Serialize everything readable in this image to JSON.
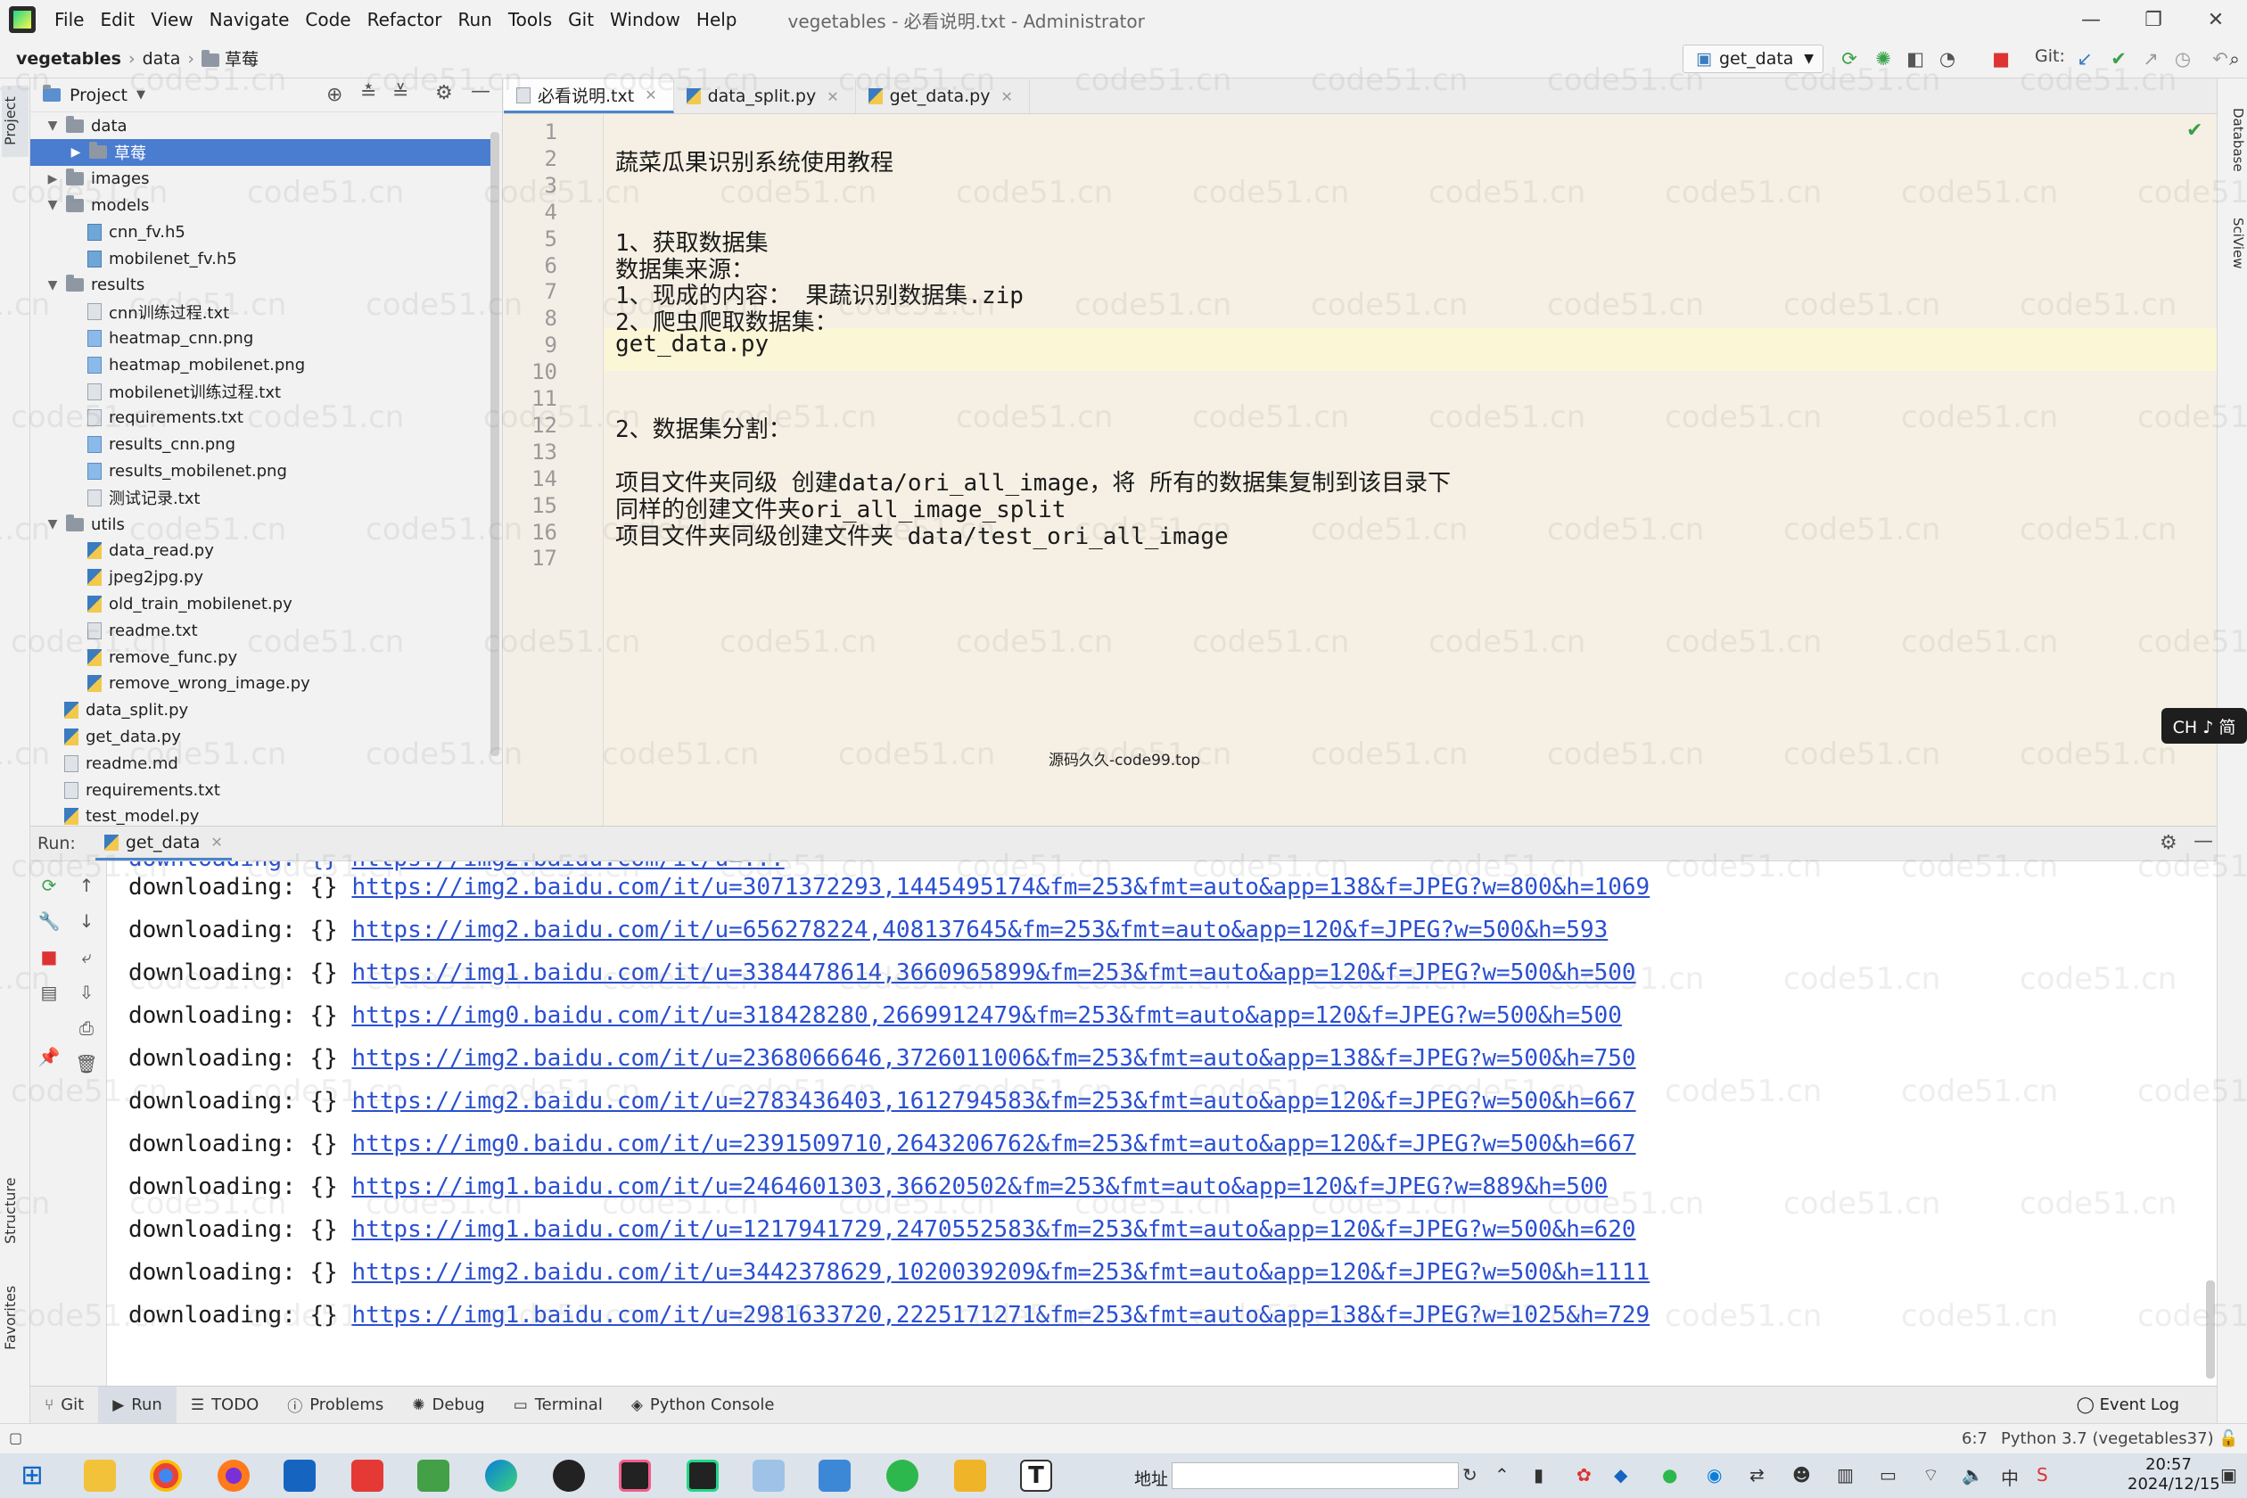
{
  "menu": {
    "items": [
      "File",
      "Edit",
      "View",
      "Navigate",
      "Code",
      "Refactor",
      "Run",
      "Tools",
      "Git",
      "Window",
      "Help"
    ],
    "window_title": "vegetables - 必看说明.txt - Administrator"
  },
  "window_controls": {
    "minimize": "—",
    "maximize": "❐",
    "close": "✕"
  },
  "breadcrumb": {
    "root": "vegetables",
    "folder": "data",
    "subfolder": "草莓"
  },
  "toolbar": {
    "run_config": "get_data",
    "git_label": "Git:"
  },
  "side_tabs": {
    "project": "Project",
    "structure": "Structure",
    "favorites": "Favorites",
    "database": "Database",
    "sciview": "SciView"
  },
  "project": {
    "title": "Project",
    "tree": [
      {
        "label": "data",
        "type": "folder",
        "depth": 1,
        "expanded": true
      },
      {
        "label": "草莓",
        "type": "folder",
        "depth": 2,
        "expanded": false,
        "selected": true
      },
      {
        "label": "images",
        "type": "folder",
        "depth": 1,
        "expanded": false
      },
      {
        "label": "models",
        "type": "folder",
        "depth": 1,
        "expanded": true
      },
      {
        "label": "cnn_fv.h5",
        "type": "h5",
        "depth": 2
      },
      {
        "label": "mobilenet_fv.h5",
        "type": "h5",
        "depth": 2
      },
      {
        "label": "results",
        "type": "folder",
        "depth": 1,
        "expanded": true
      },
      {
        "label": "cnn训练过程.txt",
        "type": "txt",
        "depth": 2
      },
      {
        "label": "heatmap_cnn.png",
        "type": "png",
        "depth": 2
      },
      {
        "label": "heatmap_mobilenet.png",
        "type": "png",
        "depth": 2
      },
      {
        "label": "mobilenet训练过程.txt",
        "type": "txt",
        "depth": 2
      },
      {
        "label": "requirements.txt",
        "type": "txt",
        "depth": 2
      },
      {
        "label": "results_cnn.png",
        "type": "png",
        "depth": 2
      },
      {
        "label": "results_mobilenet.png",
        "type": "png",
        "depth": 2
      },
      {
        "label": "测试记录.txt",
        "type": "txt",
        "depth": 2
      },
      {
        "label": "utils",
        "type": "folder",
        "depth": 1,
        "expanded": true
      },
      {
        "label": "data_read.py",
        "type": "py",
        "depth": 2
      },
      {
        "label": "jpeg2jpg.py",
        "type": "py",
        "depth": 2
      },
      {
        "label": "old_train_mobilenet.py",
        "type": "py",
        "depth": 2
      },
      {
        "label": "readme.txt",
        "type": "txt",
        "depth": 2
      },
      {
        "label": "remove_func.py",
        "type": "py",
        "depth": 2
      },
      {
        "label": "remove_wrong_image.py",
        "type": "py",
        "depth": 2
      },
      {
        "label": "data_split.py",
        "type": "py",
        "depth": 1
      },
      {
        "label": "get_data.py",
        "type": "py",
        "depth": 1
      },
      {
        "label": "readme.md",
        "type": "txt",
        "depth": 1
      },
      {
        "label": "requirements.txt",
        "type": "txt",
        "depth": 1
      },
      {
        "label": "test_model.py",
        "type": "py",
        "depth": 1
      }
    ]
  },
  "editor": {
    "tabs": [
      {
        "label": "必看说明.txt",
        "kind": "txt",
        "active": true
      },
      {
        "label": "data_split.py",
        "kind": "py",
        "active": false
      },
      {
        "label": "get_data.py",
        "kind": "py",
        "active": false
      }
    ],
    "lines": [
      {
        "no": "1",
        "text": ""
      },
      {
        "no": "2",
        "text": "蔬菜瓜果识别系统使用教程"
      },
      {
        "no": "3",
        "text": ""
      },
      {
        "no": "4",
        "text": ""
      },
      {
        "no": "5",
        "text": "1、获取数据集"
      },
      {
        "no": "6",
        "text": "数据集来源："
      },
      {
        "no": "7",
        "text": "1、现成的内容： 果蔬识别数据集.zip"
      },
      {
        "no": "8",
        "text": "2、爬虫爬取数据集："
      },
      {
        "no": "9",
        "text": "get_data.py"
      },
      {
        "no": "10",
        "text": ""
      },
      {
        "no": "11",
        "text": ""
      },
      {
        "no": "12",
        "text": "2、数据集分割："
      },
      {
        "no": "13",
        "text": ""
      },
      {
        "no": "14",
        "text": "项目文件夹同级 创建data/ori_all_image，将 所有的数据集复制到该目录下"
      },
      {
        "no": "15",
        "text": "同样的创建文件夹ori_all_image_split"
      },
      {
        "no": "16",
        "text": "项目文件夹同级创建文件夹 data/test_ori_all_image"
      },
      {
        "no": "17",
        "text": ""
      }
    ],
    "overlay_caption": "源码久久-code99.top",
    "ime_badge": "CH ♪ 简"
  },
  "run": {
    "label": "Run:",
    "tab": "get_data",
    "lines": [
      {
        "prefix": "downloading: {} ",
        "url": "https://img2.baidu.com/it/u=3071372293,1445495174&fm=253&fmt=auto&app=138&f=JPEG?w=800&h=1069"
      },
      {
        "prefix": "downloading: {} ",
        "url": "https://img2.baidu.com/it/u=656278224,408137645&fm=253&fmt=auto&app=120&f=JPEG?w=500&h=593"
      },
      {
        "prefix": "downloading: {} ",
        "url": "https://img1.baidu.com/it/u=3384478614,3660965899&fm=253&fmt=auto&app=120&f=JPEG?w=500&h=500"
      },
      {
        "prefix": "downloading: {} ",
        "url": "https://img0.baidu.com/it/u=318428280,2669912479&fm=253&fmt=auto&app=120&f=JPEG?w=500&h=500"
      },
      {
        "prefix": "downloading: {} ",
        "url": "https://img2.baidu.com/it/u=2368066646,3726011006&fm=253&fmt=auto&app=138&f=JPEG?w=500&h=750"
      },
      {
        "prefix": "downloading: {} ",
        "url": "https://img2.baidu.com/it/u=2783436403,1612794583&fm=253&fmt=auto&app=120&f=JPEG?w=500&h=667"
      },
      {
        "prefix": "downloading: {} ",
        "url": "https://img0.baidu.com/it/u=2391509710,2643206762&fm=253&fmt=auto&app=120&f=JPEG?w=500&h=667"
      },
      {
        "prefix": "downloading: {} ",
        "url": "https://img1.baidu.com/it/u=2464601303,36620502&fm=253&fmt=auto&app=120&f=JPEG?w=889&h=500"
      },
      {
        "prefix": "downloading: {} ",
        "url": "https://img1.baidu.com/it/u=1217941729,2470552583&fm=253&fmt=auto&app=120&f=JPEG?w=500&h=620"
      },
      {
        "prefix": "downloading: {} ",
        "url": "https://img2.baidu.com/it/u=3442378629,1020039209&fm=253&fmt=auto&app=120&f=JPEG?w=500&h=1111"
      },
      {
        "prefix": "downloading: {} ",
        "url": "https://img1.baidu.com/it/u=2981633720,2225171271&fm=253&fmt=auto&app=138&f=JPEG?w=1025&h=729"
      }
    ]
  },
  "tool_tabs": [
    {
      "label": "Git",
      "icon": "git-icon"
    },
    {
      "label": "Run",
      "icon": "play-icon",
      "active": true
    },
    {
      "label": "TODO",
      "icon": "list-icon"
    },
    {
      "label": "Problems",
      "icon": "info-icon"
    },
    {
      "label": "Debug",
      "icon": "bug-icon"
    },
    {
      "label": "Terminal",
      "icon": "terminal-icon"
    },
    {
      "label": "Python Console",
      "icon": "python-icon"
    }
  ],
  "event_log": "Event Log",
  "status": {
    "position": "6:7",
    "interpreter": "Python 3.7 (vegetables37)"
  },
  "taskbar": {
    "address_label": "地址",
    "time": "20:57",
    "date": "2024/12/15",
    "ime": "中"
  },
  "watermark": "code51.cn",
  "colors": {
    "selection": "#4a7cd0",
    "link": "#2a4fd0",
    "editor_bg": "#f6f0e4",
    "current_line": "#fbf6d6"
  }
}
